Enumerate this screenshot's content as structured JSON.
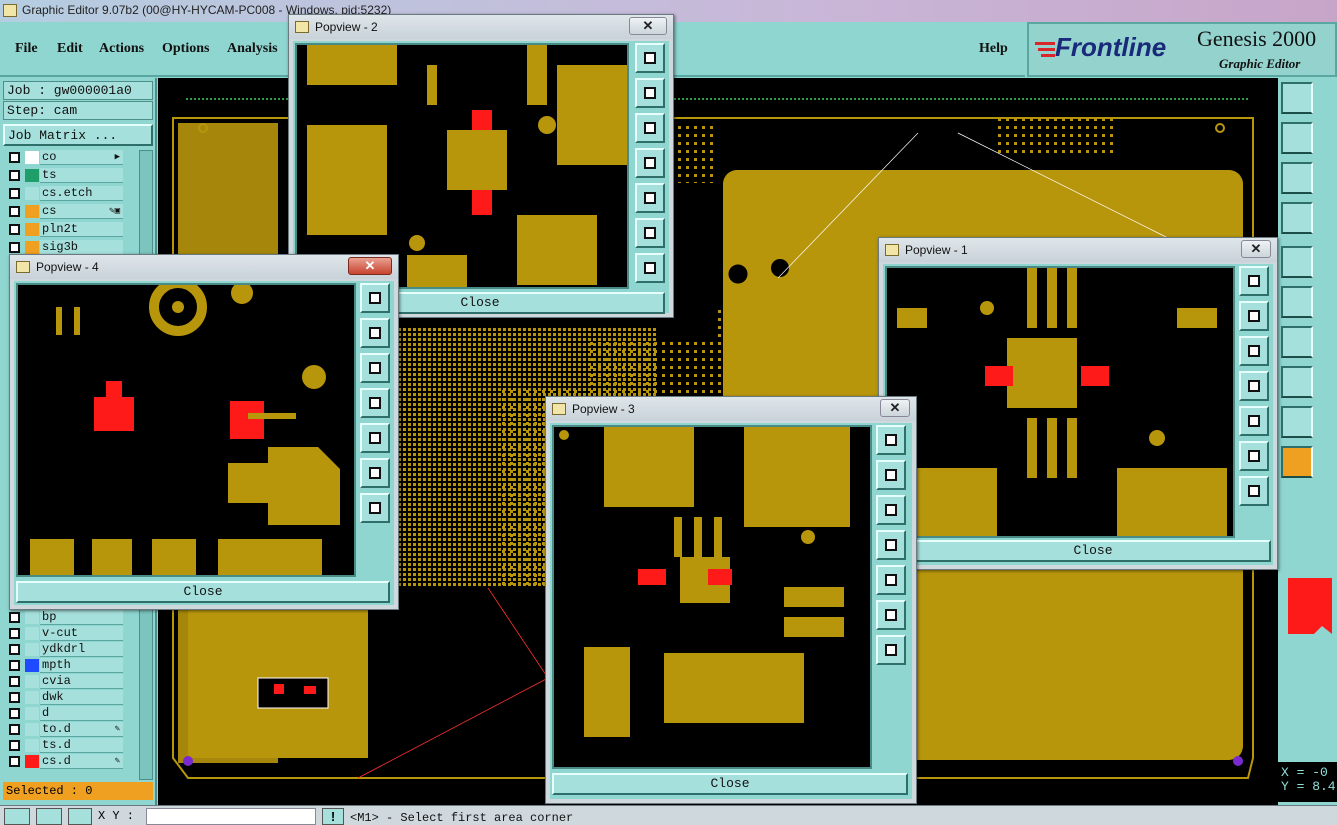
{
  "window": {
    "title": "Graphic Editor 9.07b2 (00@HY-HYCAM-PC008 - Windows, pid:5232)"
  },
  "menu": {
    "file": "File",
    "edit": "Edit",
    "actions": "Actions",
    "options": "Options",
    "analysis": "Analysis",
    "help": "Help"
  },
  "brand": {
    "logo": "Frontline",
    "product": "Genesis 2000",
    "subtitle": "Graphic Editor"
  },
  "left": {
    "job": "Job : gw000001a0",
    "step": "Step: cam",
    "matrix": "Job Matrix ...",
    "layers_top": [
      {
        "name": "co",
        "color": "#ffffff",
        "icon": "▶"
      },
      {
        "name": "ts",
        "color": "#1f9e6a",
        "icon": ""
      },
      {
        "name": "cs.etch",
        "color": "#a6e0dc",
        "icon": ""
      },
      {
        "name": "cs",
        "color": "#f0a020",
        "icon": "✎▣"
      },
      {
        "name": "pln2t",
        "color": "#f0a020",
        "icon": ""
      },
      {
        "name": "sig3b",
        "color": "#f0a020",
        "icon": ""
      }
    ],
    "layers_bottom": [
      {
        "name": "bp",
        "color": "#a6e0dc",
        "icon": ""
      },
      {
        "name": "v-cut",
        "color": "#a6e0dc",
        "icon": ""
      },
      {
        "name": "ydkdrl",
        "color": "#a6e0dc",
        "icon": ""
      },
      {
        "name": "mpth",
        "color": "#1e4bff",
        "icon": ""
      },
      {
        "name": "cvia",
        "color": "#a6e0dc",
        "icon": ""
      },
      {
        "name": "dwk",
        "color": "#a6e0dc",
        "icon": ""
      },
      {
        "name": "d",
        "color": "#a6e0dc",
        "icon": ""
      },
      {
        "name": "to.d",
        "color": "#a6e0dc",
        "icon": "✎"
      },
      {
        "name": "ts.d",
        "color": "#a6e0dc",
        "icon": ""
      },
      {
        "name": "cs.d",
        "color": "#ff1a1a",
        "icon": "✎"
      }
    ],
    "selected": "Selected : 0"
  },
  "popups": [
    {
      "title": "Popview - 2",
      "close_label": "Close"
    },
    {
      "title": "Popview - 4",
      "close_label": "Close"
    },
    {
      "title": "Popview - 1",
      "close_label": "Close"
    },
    {
      "title": "Popview - 3",
      "close_label": "Close"
    }
  ],
  "status": {
    "xy_label": "X Y :",
    "xy_value": "",
    "message": "<M1> - Select first area corner"
  },
  "coords": {
    "x": "X = -0",
    "y": "Y = 8.4"
  },
  "colors": {
    "panel": "#8fd5d0",
    "copper": "#b8960c",
    "highlight": "#ff1a1a",
    "canvas": "#000000"
  }
}
